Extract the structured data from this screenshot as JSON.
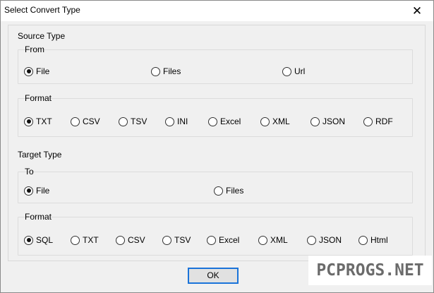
{
  "window": {
    "title": "Select Convert Type",
    "close_glyph": "✕"
  },
  "source": {
    "section_label": "Source Type",
    "from": {
      "label": "From",
      "options": [
        "File",
        "Files",
        "Url"
      ],
      "selected": "File"
    },
    "format": {
      "label": "Format",
      "options": [
        "TXT",
        "CSV",
        "TSV",
        "INI",
        "Excel",
        "XML",
        "JSON",
        "RDF"
      ],
      "selected": "TXT"
    }
  },
  "target": {
    "section_label": "Target Type",
    "to": {
      "label": "To",
      "options": [
        "File",
        "Files"
      ],
      "selected": "File"
    },
    "format": {
      "label": "Format",
      "options": [
        "SQL",
        "TXT",
        "CSV",
        "TSV",
        "Excel",
        "XML",
        "JSON",
        "Html"
      ],
      "selected": "SQL"
    }
  },
  "buttons": {
    "ok_label": "OK"
  },
  "watermark": {
    "text": "PCPROGS.NET"
  }
}
